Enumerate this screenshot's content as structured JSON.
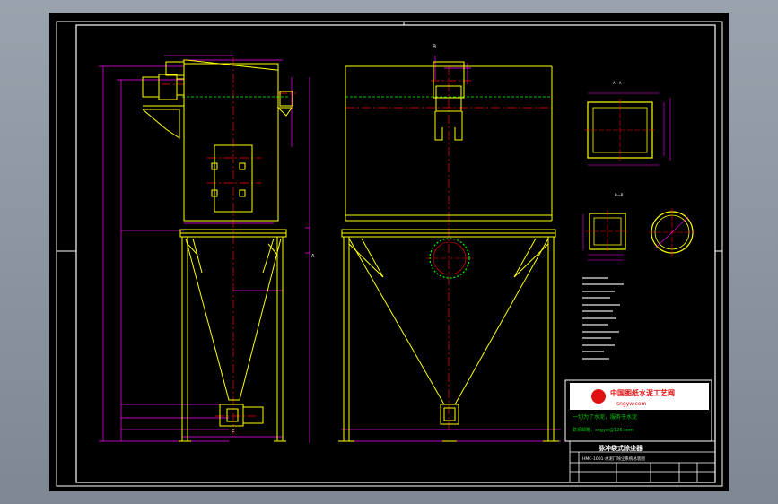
{
  "drawing": {
    "view_labels": {
      "side_view_tag": "A",
      "front_view_tag": "B",
      "section_a": "A—A",
      "section_b": "B—B",
      "bottom_marker": "C"
    },
    "logo": {
      "org_name": "中国图纸水泥工艺网",
      "website": "sngyw.com",
      "slogan": "一切为了水泥，服务于水泥",
      "contact": "联系邮箱：sngyw@126.com"
    },
    "title_block": {
      "drawing_title": "脉冲袋式除尘器",
      "project_note": "HMC-1001·水泥厂除尘系统总装图"
    }
  },
  "colors": {
    "background": "#000000",
    "frame": "#ffffff",
    "structure": "#ffff00",
    "dimension": "#ff00ff",
    "centerline": "#ff0000",
    "hidden": "#00ff00",
    "logo_red": "#e01010",
    "logo_green": "#00cc00"
  }
}
